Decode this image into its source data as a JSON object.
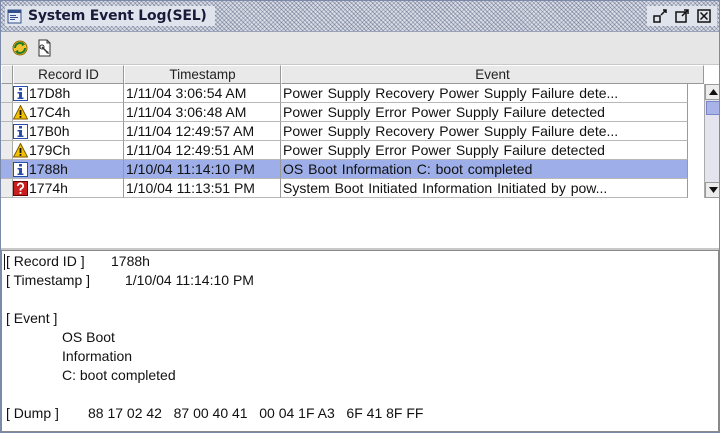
{
  "window": {
    "title": "System Event Log(SEL)"
  },
  "toolbar": {
    "refresh_icon": "refresh-icon",
    "properties_icon": "properties-icon"
  },
  "table": {
    "columns": [
      "Record ID",
      "Timestamp",
      "Event"
    ],
    "selected_index": 4,
    "rows": [
      {
        "icon": "info",
        "id": "17D8h",
        "timestamp": "1/11/04 3:06:54 AM",
        "event": "Power Supply   Recovery   Power Supply Failure dete..."
      },
      {
        "icon": "warning",
        "id": "17C4h",
        "timestamp": "1/11/04 3:06:48 AM",
        "event": "Power Supply   Error   Power Supply Failure detected"
      },
      {
        "icon": "info",
        "id": "17B0h",
        "timestamp": "1/11/04 12:49:57 AM",
        "event": "Power Supply   Recovery   Power Supply Failure dete..."
      },
      {
        "icon": "warning",
        "id": "179Ch",
        "timestamp": "1/11/04 12:49:51 AM",
        "event": "Power Supply   Error   Power Supply Failure detected"
      },
      {
        "icon": "info",
        "id": "1788h",
        "timestamp": "1/10/04 11:14:10 PM",
        "event": "OS Boot   Information   C: boot completed"
      },
      {
        "icon": "question",
        "id": "1774h",
        "timestamp": "1/10/04 11:13:51 PM",
        "event": "System Boot Initiated   Information   Initiated by pow..."
      }
    ]
  },
  "detail": {
    "record_id_label": "[ Record ID ]",
    "record_id_value": "1788h",
    "timestamp_label": "[ Timestamp ]",
    "timestamp_value": "1/10/04 11:14:10 PM",
    "event_label": "[ Event ]",
    "event_lines": [
      "OS Boot",
      "Information",
      "C: boot completed"
    ],
    "dump_label": "[ Dump ]",
    "dump_value": "88 17 02 42   87 00 40 41   00 04 1F A3   6F 41 8F FF"
  },
  "colors": {
    "selection": "#9daee8",
    "info_icon": "#2a4fa8",
    "warning_icon": "#f2c200",
    "question_icon": "#c81e1e"
  }
}
